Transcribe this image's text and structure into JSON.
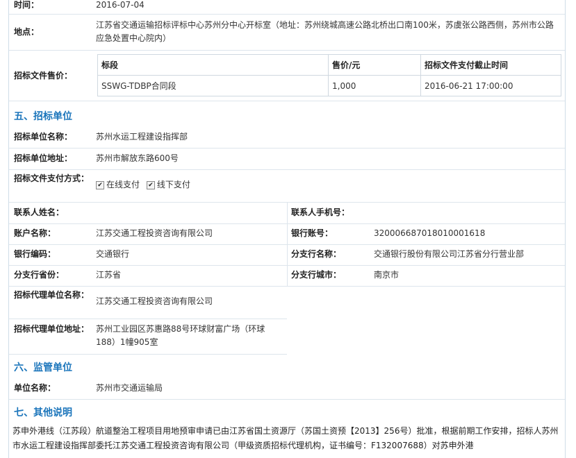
{
  "time": {
    "label": "时间：",
    "value": "2016-07-04"
  },
  "location": {
    "label": "地点：",
    "value": "江苏省交通运输招标评标中心苏州分中心开标室（地址：苏州绕城高速公路北桥出口南100米，苏虞张公路西侧，苏州市公路应急处置中心院内）"
  },
  "fee": {
    "label": "招标文件售价：",
    "headers": [
      "标段",
      "售价/元",
      "招标文件支付截止时间"
    ],
    "rows": [
      [
        "SSWG-TDBP合同段",
        "1,000",
        "2016-06-21 17:00:00"
      ]
    ]
  },
  "section5": {
    "title": "五、招标单位",
    "name_label": "招标单位名称：",
    "name": "苏州水运工程建设指挥部",
    "address_label": "招标单位地址：",
    "address": "苏州市解放东路600号",
    "pay_label": "招标文件支付方式：",
    "pay_online": "在线支付",
    "pay_offline": "线下支付",
    "contact_label": "联系人姓名：",
    "contact": "",
    "phone_label": "联系人手机号：",
    "phone": "",
    "account_label": "账户名称：",
    "account": "江苏交通工程投资咨询有限公司",
    "bankno_label": "银行账号：",
    "bankno": "32000668701801000​1618",
    "bankcode_label": "银行编码：",
    "bankcode": "交通银行",
    "branch_label": "分支行名称：",
    "branch": "交通银行股份有限公司江苏省分行营业部",
    "province_label": "分支行省份：",
    "province": "江苏省",
    "city_label": "分支行城市：",
    "city": "南京市",
    "agent_label": "招标代理单位名称：",
    "agent": "江苏交通工程投资咨询有限公司",
    "agent_addr_label": "招标代理单位地址：",
    "agent_addr": "苏州工业园区苏惠路88号环球财富广场（环球188）1幢905室"
  },
  "section6": {
    "title": "六、监管单位",
    "unit_label": "单位名称：",
    "unit": "苏州市交通运输局"
  },
  "section7": {
    "title": "七、其他说明",
    "text": "苏申外港线（江苏段）航道整治工程项目用地预审申请已由江苏省国土资源厅（苏国土资预【2013】256号）批准，根据前期工作安排，招标人苏州市水运工程建设指挥部委托江苏交通工程投资咨询有限公司（甲级资质招标代理机构，证书编号：F132007688）对苏申外港"
  }
}
